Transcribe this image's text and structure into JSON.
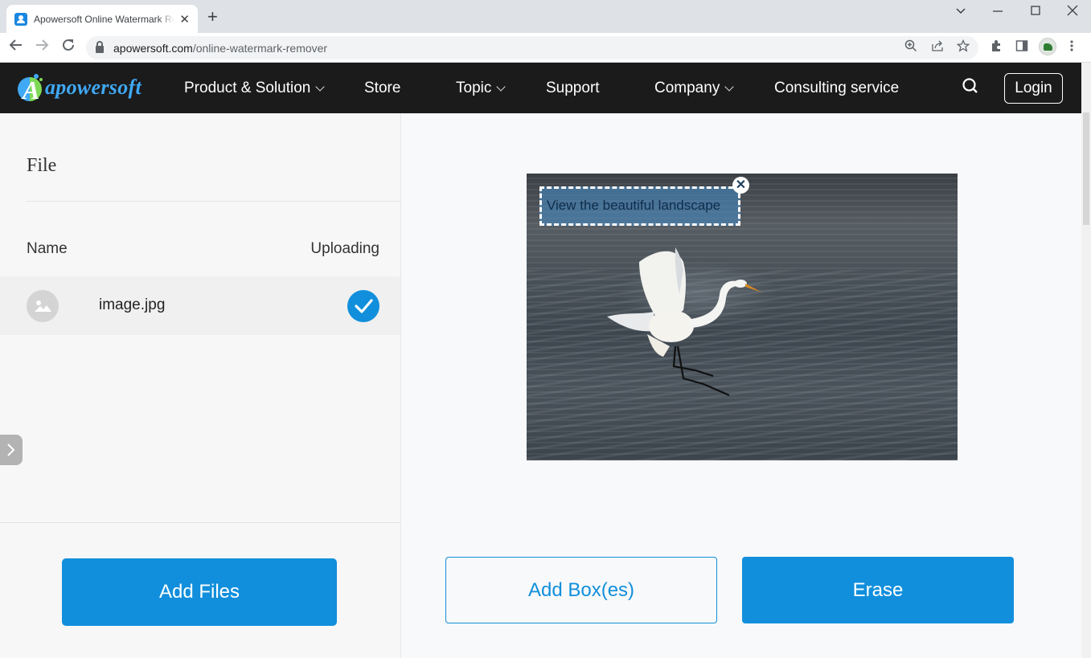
{
  "browser": {
    "tab_title": "Apowersoft Online Watermark Remover",
    "new_tab_icon": "plus-icon",
    "window_controls": [
      "tab-search-icon",
      "minimize-icon",
      "maximize-icon",
      "close-icon"
    ],
    "url_domain": "apowersoft.com",
    "url_path": "/online-watermark-remover",
    "toolbar_icons": [
      "zoom-icon",
      "share-icon",
      "bookmark-star-icon",
      "extensions-icon",
      "side-panel-icon",
      "profile-avatar",
      "menu-icon"
    ]
  },
  "header": {
    "logo_letter": "A",
    "logo_text": "apowersoft",
    "nav": [
      {
        "label": "Product & Solution",
        "dropdown": true
      },
      {
        "label": "Store",
        "dropdown": false
      },
      {
        "label": "Topic",
        "dropdown": true
      },
      {
        "label": "Support",
        "dropdown": false
      },
      {
        "label": "Company",
        "dropdown": true
      },
      {
        "label": "Consulting service",
        "dropdown": false
      }
    ],
    "login_label": "Login"
  },
  "file_panel": {
    "heading": "File",
    "col_name": "Name",
    "col_status": "Uploading",
    "files": [
      {
        "name": "image.jpg",
        "status": "uploaded"
      }
    ],
    "add_files_label": "Add Files"
  },
  "editor": {
    "image_alt": "Great egret landing on water",
    "watermark_text": "View the beautiful landscape",
    "add_box_label": "Add Box(es)",
    "erase_label": "Erase"
  },
  "colors": {
    "accent": "#118fdc",
    "header_bg": "#1b1b1b",
    "logo_blue": "#3fa9f5",
    "logo_green": "#7ed957"
  }
}
